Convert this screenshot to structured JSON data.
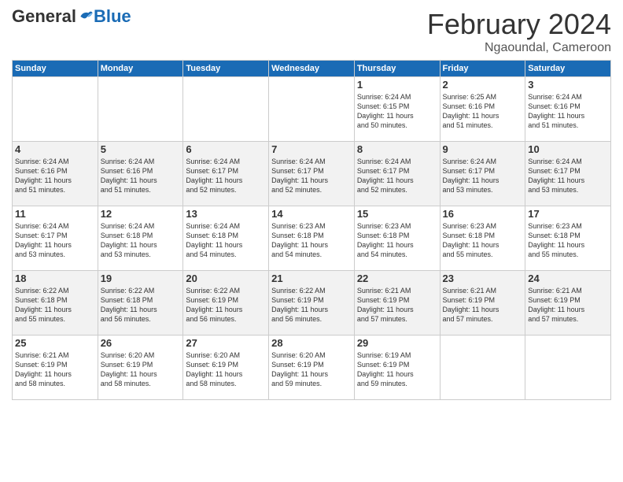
{
  "header": {
    "logo_general": "General",
    "logo_blue": "Blue",
    "month_title": "February 2024",
    "subtitle": "Ngaoundal, Cameroon"
  },
  "days_of_week": [
    "Sunday",
    "Monday",
    "Tuesday",
    "Wednesday",
    "Thursday",
    "Friday",
    "Saturday"
  ],
  "weeks": [
    [
      {
        "day": "",
        "info": ""
      },
      {
        "day": "",
        "info": ""
      },
      {
        "day": "",
        "info": ""
      },
      {
        "day": "",
        "info": ""
      },
      {
        "day": "1",
        "info": "Sunrise: 6:24 AM\nSunset: 6:15 PM\nDaylight: 11 hours\nand 50 minutes."
      },
      {
        "day": "2",
        "info": "Sunrise: 6:25 AM\nSunset: 6:16 PM\nDaylight: 11 hours\nand 51 minutes."
      },
      {
        "day": "3",
        "info": "Sunrise: 6:24 AM\nSunset: 6:16 PM\nDaylight: 11 hours\nand 51 minutes."
      }
    ],
    [
      {
        "day": "4",
        "info": "Sunrise: 6:24 AM\nSunset: 6:16 PM\nDaylight: 11 hours\nand 51 minutes."
      },
      {
        "day": "5",
        "info": "Sunrise: 6:24 AM\nSunset: 6:16 PM\nDaylight: 11 hours\nand 51 minutes."
      },
      {
        "day": "6",
        "info": "Sunrise: 6:24 AM\nSunset: 6:17 PM\nDaylight: 11 hours\nand 52 minutes."
      },
      {
        "day": "7",
        "info": "Sunrise: 6:24 AM\nSunset: 6:17 PM\nDaylight: 11 hours\nand 52 minutes."
      },
      {
        "day": "8",
        "info": "Sunrise: 6:24 AM\nSunset: 6:17 PM\nDaylight: 11 hours\nand 52 minutes."
      },
      {
        "day": "9",
        "info": "Sunrise: 6:24 AM\nSunset: 6:17 PM\nDaylight: 11 hours\nand 53 minutes."
      },
      {
        "day": "10",
        "info": "Sunrise: 6:24 AM\nSunset: 6:17 PM\nDaylight: 11 hours\nand 53 minutes."
      }
    ],
    [
      {
        "day": "11",
        "info": "Sunrise: 6:24 AM\nSunset: 6:17 PM\nDaylight: 11 hours\nand 53 minutes."
      },
      {
        "day": "12",
        "info": "Sunrise: 6:24 AM\nSunset: 6:18 PM\nDaylight: 11 hours\nand 53 minutes."
      },
      {
        "day": "13",
        "info": "Sunrise: 6:24 AM\nSunset: 6:18 PM\nDaylight: 11 hours\nand 54 minutes."
      },
      {
        "day": "14",
        "info": "Sunrise: 6:23 AM\nSunset: 6:18 PM\nDaylight: 11 hours\nand 54 minutes."
      },
      {
        "day": "15",
        "info": "Sunrise: 6:23 AM\nSunset: 6:18 PM\nDaylight: 11 hours\nand 54 minutes."
      },
      {
        "day": "16",
        "info": "Sunrise: 6:23 AM\nSunset: 6:18 PM\nDaylight: 11 hours\nand 55 minutes."
      },
      {
        "day": "17",
        "info": "Sunrise: 6:23 AM\nSunset: 6:18 PM\nDaylight: 11 hours\nand 55 minutes."
      }
    ],
    [
      {
        "day": "18",
        "info": "Sunrise: 6:22 AM\nSunset: 6:18 PM\nDaylight: 11 hours\nand 55 minutes."
      },
      {
        "day": "19",
        "info": "Sunrise: 6:22 AM\nSunset: 6:18 PM\nDaylight: 11 hours\nand 56 minutes."
      },
      {
        "day": "20",
        "info": "Sunrise: 6:22 AM\nSunset: 6:19 PM\nDaylight: 11 hours\nand 56 minutes."
      },
      {
        "day": "21",
        "info": "Sunrise: 6:22 AM\nSunset: 6:19 PM\nDaylight: 11 hours\nand 56 minutes."
      },
      {
        "day": "22",
        "info": "Sunrise: 6:21 AM\nSunset: 6:19 PM\nDaylight: 11 hours\nand 57 minutes."
      },
      {
        "day": "23",
        "info": "Sunrise: 6:21 AM\nSunset: 6:19 PM\nDaylight: 11 hours\nand 57 minutes."
      },
      {
        "day": "24",
        "info": "Sunrise: 6:21 AM\nSunset: 6:19 PM\nDaylight: 11 hours\nand 57 minutes."
      }
    ],
    [
      {
        "day": "25",
        "info": "Sunrise: 6:21 AM\nSunset: 6:19 PM\nDaylight: 11 hours\nand 58 minutes."
      },
      {
        "day": "26",
        "info": "Sunrise: 6:20 AM\nSunset: 6:19 PM\nDaylight: 11 hours\nand 58 minutes."
      },
      {
        "day": "27",
        "info": "Sunrise: 6:20 AM\nSunset: 6:19 PM\nDaylight: 11 hours\nand 58 minutes."
      },
      {
        "day": "28",
        "info": "Sunrise: 6:20 AM\nSunset: 6:19 PM\nDaylight: 11 hours\nand 59 minutes."
      },
      {
        "day": "29",
        "info": "Sunrise: 6:19 AM\nSunset: 6:19 PM\nDaylight: 11 hours\nand 59 minutes."
      },
      {
        "day": "",
        "info": ""
      },
      {
        "day": "",
        "info": ""
      }
    ]
  ]
}
